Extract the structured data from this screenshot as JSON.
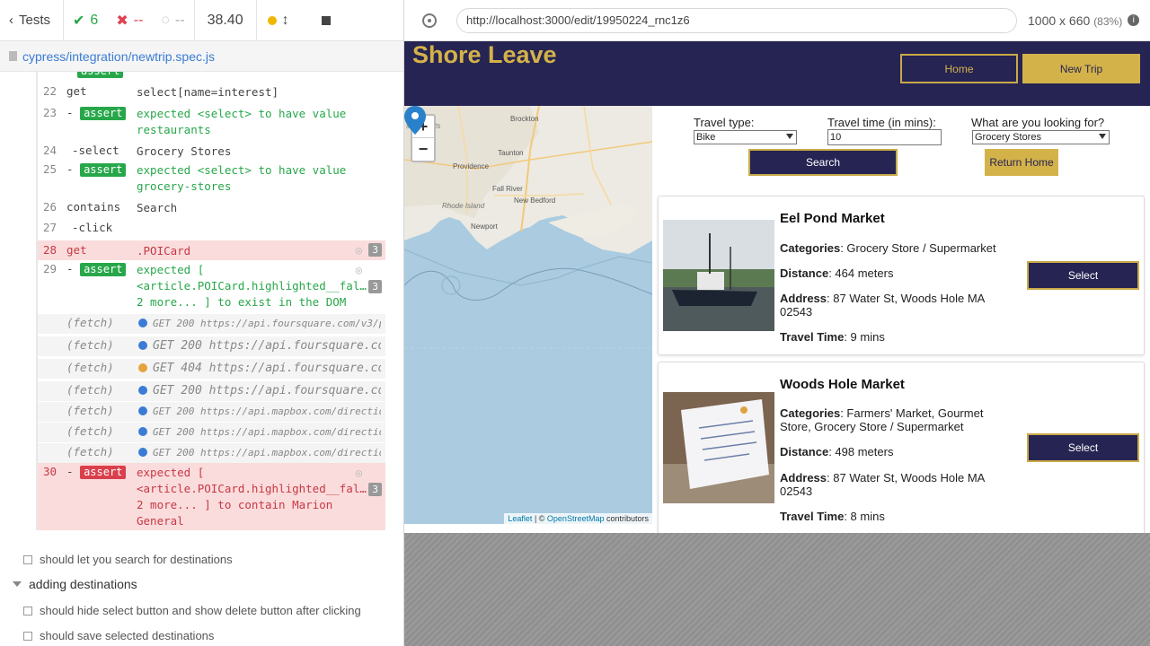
{
  "reporter": {
    "tests_label": "Tests",
    "passed": "6",
    "failed": "--",
    "pending": "--",
    "duration": "38.40",
    "spec_file": "cypress/integration/newtrip.spec.js",
    "commands": [
      {
        "num": "22",
        "name": "get",
        "msg": "select[name=interest]"
      },
      {
        "num": "23",
        "name": "assert",
        "msg1": "expected <select> to have value",
        "msg2": "restaurants"
      },
      {
        "num": "24",
        "name": "-select",
        "msg": "Grocery Stores"
      },
      {
        "num": "25",
        "name": "assert",
        "msg1": "expected <select> to have value",
        "msg2": "grocery-stores"
      },
      {
        "num": "26",
        "name": "contains",
        "msg": "Search"
      },
      {
        "num": "27",
        "name": "-click",
        "msg": ""
      },
      {
        "num": "28",
        "name": "get",
        "msg": ".POICard",
        "count": "3"
      },
      {
        "num": "29",
        "name": "assert",
        "msg1": "expected [",
        "msg2": "<article.POICard.highlighted__fal…",
        "msg3": "2 more... ] to exist in the DOM",
        "count": "3"
      },
      {
        "num": "30",
        "name": "assert",
        "msg1": "expected [",
        "msg2": "<article.POICard.highlighted__fal…",
        "msg3": "2 more... ] to contain Marion",
        "msg4": "General",
        "count": "3"
      }
    ],
    "fetches": [
      {
        "label": "(fetch)",
        "text": "GET 200 https://api.foursquare.com/v3/pl…",
        "color": "blue"
      },
      {
        "label": "(fetch)",
        "text": "GET 200 https://api.foursquare.co…",
        "color": "blue"
      },
      {
        "label": "(fetch)",
        "text": "GET 404 https://api.foursquare.co…",
        "color": "orange"
      },
      {
        "label": "(fetch)",
        "text": "GET 200 https://api.foursquare.co…",
        "color": "blue"
      },
      {
        "label": "(fetch)",
        "text": "GET 200 https://api.mapbox.com/direction…",
        "color": "blue"
      },
      {
        "label": "(fetch)",
        "text": "GET 200 https://api.mapbox.com/direction…",
        "color": "blue"
      },
      {
        "label": "(fetch)",
        "text": "GET 200 https://api.mapbox.com/direction…",
        "color": "blue"
      }
    ],
    "tests": {
      "t1": "should let you search for destinations",
      "suite": "adding destinations",
      "t2": "should hide select button and show delete button after clicking",
      "t3": "should save selected destinations"
    }
  },
  "browser": {
    "url": "http://localhost:3000/edit/19950224_rnc1z6",
    "viewport": "1000 x 660",
    "zoom": "(83%)"
  },
  "app": {
    "brand": "Shore Leave",
    "nav": {
      "home": "Home",
      "new_trip": "New Trip"
    },
    "map": {
      "zoom_in": "+",
      "zoom_out": "−",
      "attrib_leaflet": "Leaflet",
      "attrib_sep": " | © ",
      "attrib_osm": "OpenStreetMap",
      "attrib_tail": " contributors",
      "places": [
        "Brockton",
        "sachusetts",
        "Providence",
        "Taunton",
        "Fall River",
        "New Bedford",
        "Rhode Island",
        "Newport"
      ]
    },
    "form": {
      "travel_type_label": "Travel type:",
      "travel_type_value": "Bike",
      "travel_time_label": "Travel time (in mins):",
      "travel_time_value": "10",
      "interest_label": "What are you looking for?",
      "interest_value": "Grocery Stores",
      "search": "Search",
      "return_home": "Return Home"
    },
    "cards": [
      {
        "name": "Eel Pond Market",
        "categories_label": "Categories",
        "categories": ": Grocery Store / Supermarket",
        "distance_label": "Distance",
        "distance": ": 464 meters",
        "address_label": "Address",
        "address": ": 87 Water St, Woods Hole MA 02543",
        "time_label": "Travel Time",
        "time": ": 9 mins",
        "select": "Select"
      },
      {
        "name": "Woods Hole Market",
        "categories_label": "Categories",
        "categories": ": Farmers' Market, Gourmet Store, Grocery Store / Supermarket",
        "distance_label": "Distance",
        "distance": ": 498 meters",
        "address_label": "Address",
        "address": ": 87 Water St, Woods Hole MA 02543",
        "time_label": "Travel Time",
        "time": ": 8 mins",
        "select": "Select"
      }
    ]
  },
  "colors": {
    "navy": "#262452",
    "gold": "#d4b24a",
    "pass": "#27a74a",
    "fail": "#e0404f"
  }
}
